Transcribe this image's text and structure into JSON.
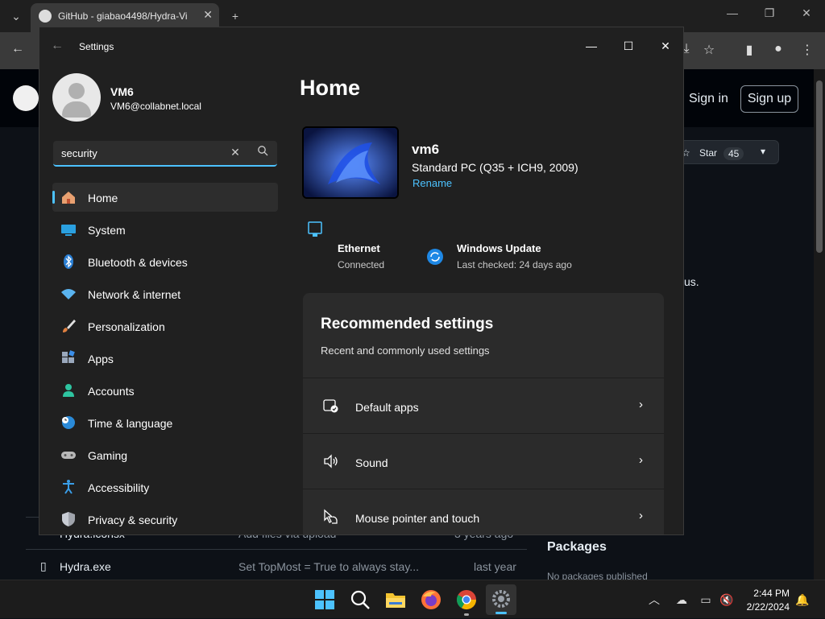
{
  "browser": {
    "tab_title": "GitHub - giabao4498/Hydra-Vi",
    "new_tab": "+",
    "header": {
      "sign_in": "Sign in",
      "sign_up": "Sign up"
    },
    "star_label": "Star",
    "star_count": "45",
    "body_fragment": "us.",
    "files": [
      {
        "name": "Hydra.iconsx",
        "commit": "Add files via upload",
        "age": "3 years ago"
      },
      {
        "name": "Hydra.exe",
        "commit": "Set TopMost = True to always stay...",
        "age": "last year"
      }
    ],
    "packages_title": "Packages",
    "packages_sub": "No packages published"
  },
  "settings": {
    "window_title": "Settings",
    "user": {
      "name": "VM6",
      "email": "VM6@collabnet.local"
    },
    "search": {
      "value": "security"
    },
    "nav": [
      {
        "label": "Home",
        "icon": "home-icon",
        "active": true
      },
      {
        "label": "System",
        "icon": "display-icon"
      },
      {
        "label": "Bluetooth & devices",
        "icon": "bluetooth-icon"
      },
      {
        "label": "Network & internet",
        "icon": "wifi-icon"
      },
      {
        "label": "Personalization",
        "icon": "brush-icon"
      },
      {
        "label": "Apps",
        "icon": "apps-icon"
      },
      {
        "label": "Accounts",
        "icon": "person-icon"
      },
      {
        "label": "Time & language",
        "icon": "globe-clock-icon"
      },
      {
        "label": "Gaming",
        "icon": "gamepad-icon"
      },
      {
        "label": "Accessibility",
        "icon": "accessibility-icon"
      },
      {
        "label": "Privacy & security",
        "icon": "shield-icon"
      }
    ],
    "home": {
      "title": "Home",
      "pc_name": "vm6",
      "pc_desc": "Standard PC (Q35 + ICH9, 2009)",
      "rename": "Rename",
      "ethernet_title": "Ethernet",
      "ethernet_status": "Connected",
      "update_title": "Windows Update",
      "update_status": "Last checked: 24 days ago",
      "rec_title": "Recommended settings",
      "rec_sub": "Recent and commonly used settings",
      "rec_items": [
        {
          "label": "Default apps",
          "icon": "default-apps-icon"
        },
        {
          "label": "Sound",
          "icon": "speaker-icon"
        },
        {
          "label": "Mouse pointer and touch",
          "icon": "pointer-icon"
        }
      ]
    }
  },
  "taskbar": {
    "time": "2:44 PM",
    "date": "2/22/2024"
  },
  "colors": {
    "accent": "#4cc2ff",
    "bg": "#202020",
    "card": "#2b2b2b"
  }
}
